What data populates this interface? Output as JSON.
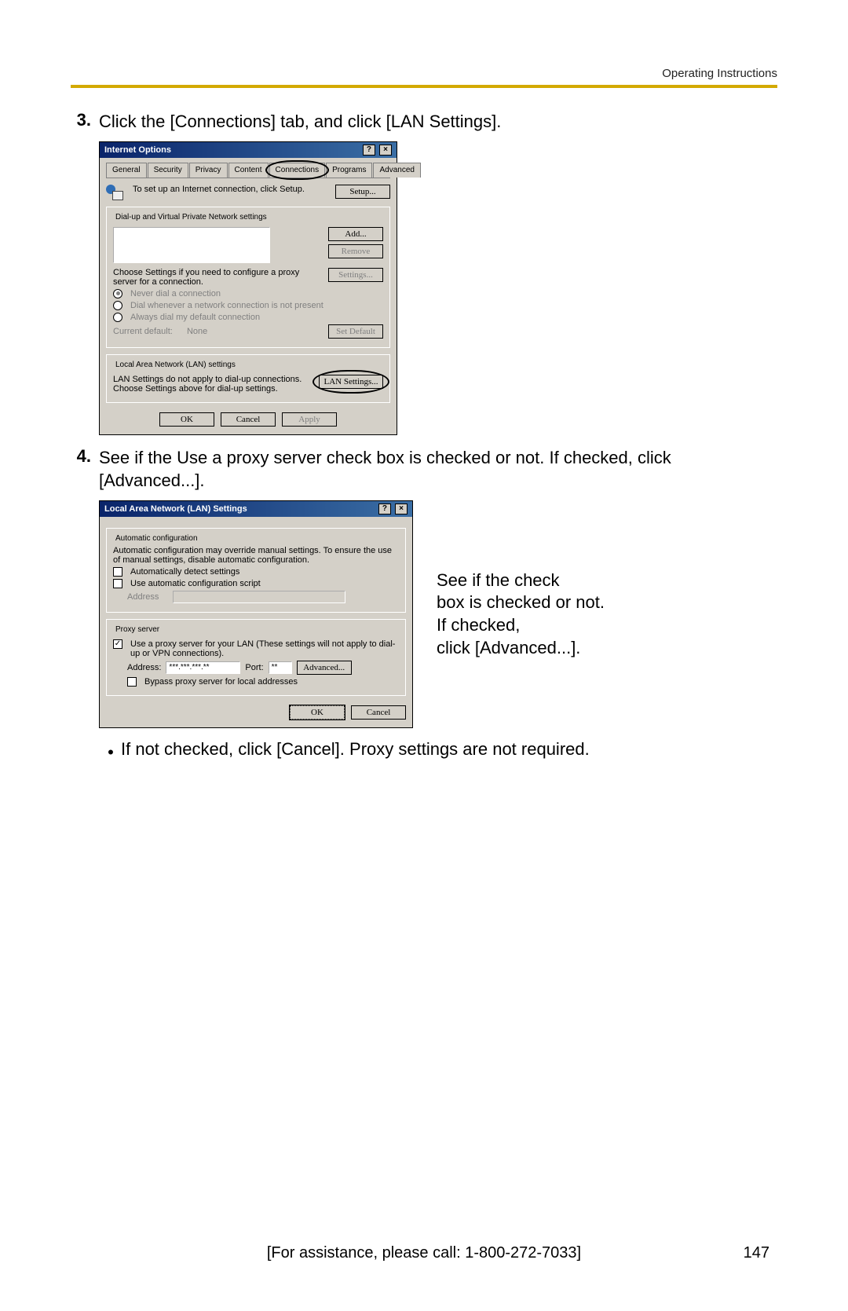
{
  "header": {
    "right": "Operating Instructions"
  },
  "steps": {
    "s3": {
      "num": "3.",
      "text": "Click the [Connections] tab, and click [LAN Settings]."
    },
    "s4": {
      "num": "4.",
      "text": "See if the Use a proxy server check box is checked or not. If checked, click [Advanced...]."
    }
  },
  "bullet1": "If not checked, click [Cancel]. Proxy settings are not required.",
  "annot": {
    "line1": "See if the check",
    "line2": "box is checked or not.",
    "line3": "If checked,",
    "line4": "click [Advanced...]."
  },
  "footer": {
    "center": "[For assistance, please call: 1-800-272-7033]",
    "page": "147"
  },
  "dlg1": {
    "title": "Internet Options",
    "tabs": [
      "General",
      "Security",
      "Privacy",
      "Content",
      "Connections",
      "Programs",
      "Advanced"
    ],
    "setup_text": "To set up an Internet connection, click Setup.",
    "setup_btn": "Setup...",
    "dialup_legend": "Dial-up and Virtual Private Network settings",
    "add_btn": "Add...",
    "remove_btn": "Remove",
    "settings_hint": "Choose Settings if you need to configure a proxy server for a connection.",
    "settings_btn": "Settings...",
    "radio1": "Never dial a connection",
    "radio2": "Dial whenever a network connection is not present",
    "radio3": "Always dial my default connection",
    "cur_default_lbl": "Current default:",
    "cur_default_val": "None",
    "setdefault_btn": "Set Default",
    "lan_legend": "Local Area Network (LAN) settings",
    "lan_text": "LAN Settings do not apply to dial-up connections. Choose Settings above for dial-up settings.",
    "lan_btn": "LAN Settings...",
    "ok": "OK",
    "cancel": "Cancel",
    "apply": "Apply"
  },
  "dlg2": {
    "title": "Local Area Network (LAN) Settings",
    "auto_legend": "Automatic configuration",
    "auto_text": "Automatic configuration may override manual settings. To ensure the use of manual settings, disable automatic configuration.",
    "chk_auto_detect": "Automatically detect settings",
    "chk_auto_script": "Use automatic configuration script",
    "address_lbl": "Address",
    "proxy_legend": "Proxy server",
    "chk_proxy": "Use a proxy server for your LAN (These settings will not apply to dial-up or VPN connections).",
    "addr_lbl": "Address:",
    "addr_val": "***.***.***.**",
    "port_lbl": "Port:",
    "port_val": "**",
    "advanced_btn": "Advanced...",
    "chk_bypass": "Bypass proxy server for local addresses",
    "ok": "OK",
    "cancel": "Cancel"
  }
}
